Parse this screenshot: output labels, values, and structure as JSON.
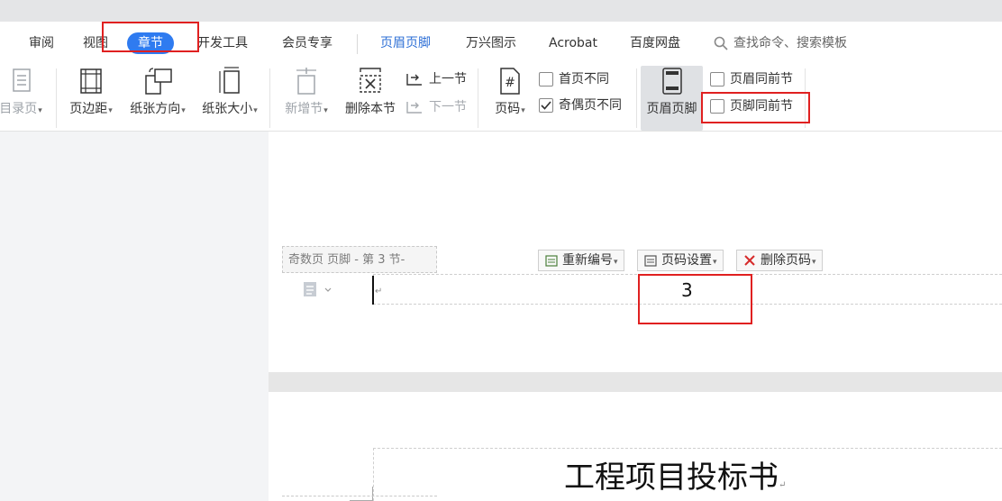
{
  "menu": {
    "tabs": [
      {
        "label": "审阅"
      },
      {
        "label": "视图"
      },
      {
        "label": "章节"
      },
      {
        "label": "开发工具"
      },
      {
        "label": "会员专享"
      },
      {
        "label": "页眉页脚"
      },
      {
        "label": "万兴图示"
      },
      {
        "label": "Acrobat"
      },
      {
        "label": "百度网盘"
      }
    ],
    "active_tab": "章节",
    "search_label": "查找命令、搜索模板"
  },
  "toolbar": {
    "catalog_page": "目录页",
    "margins": "页边距",
    "orientation": "纸张方向",
    "paper_size": "纸张大小",
    "add_section": "新增节",
    "delete_section": "删除本节",
    "prev_section": "上一节",
    "next_section": "下一节",
    "page_number": "页码",
    "first_page_diff": "首页不同",
    "odd_even_diff": "奇偶页不同",
    "header_footer": "页眉页脚",
    "header_same_prev": "页眉同前节",
    "footer_same_prev": "页脚同前节"
  },
  "document": {
    "footer_label": "奇数页 页脚  - 第 3 节-",
    "renumber_button": "重新编号",
    "page_number_settings_button": "页码设置",
    "delete_page_number_button": "删除页码",
    "page_number_value": "3",
    "next_page_title": "工程项目投标书",
    "paragraph_mark": "↵"
  },
  "colors": {
    "accent": "#2f7bf0",
    "highlight_red": "#e02020",
    "header_footer_tab": "#2d6fd6"
  }
}
